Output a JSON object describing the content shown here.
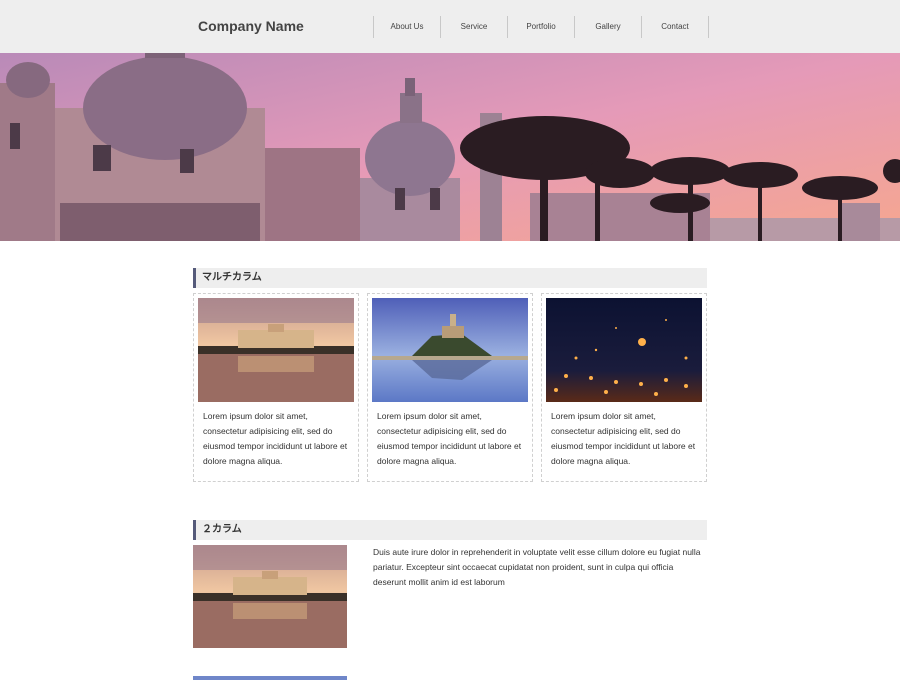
{
  "header": {
    "company_name": "Company Name",
    "nav": [
      "About Us",
      "Service",
      "Portfolio",
      "Gallery",
      "Contact"
    ]
  },
  "sections": {
    "multi_column_title": "マルチカラム",
    "two_column_title": "２カラム"
  },
  "columns": [
    {
      "text": "Lorem ipsum dolor sit amet, consectetur adipisicing elit, sed do eiusmod tempor incididunt ut labore et dolore magna aliqua."
    },
    {
      "text": "Lorem ipsum dolor sit amet, consectetur adipisicing elit, sed do eiusmod tempor incididunt ut labore et dolore magna aliqua."
    },
    {
      "text": "Lorem ipsum dolor sit amet, consectetur adipisicing elit, sed do eiusmod tempor incididunt ut labore et dolore magna aliqua."
    }
  ],
  "two_column": {
    "text": "Duis aute irure dolor in reprehenderit in voluptate velit esse cillum dolore eu fugiat nulla pariatur. Excepteur sint occaecat cupidatat non proident, sunt in culpa qui officia deserunt mollit anim id est laborum"
  }
}
